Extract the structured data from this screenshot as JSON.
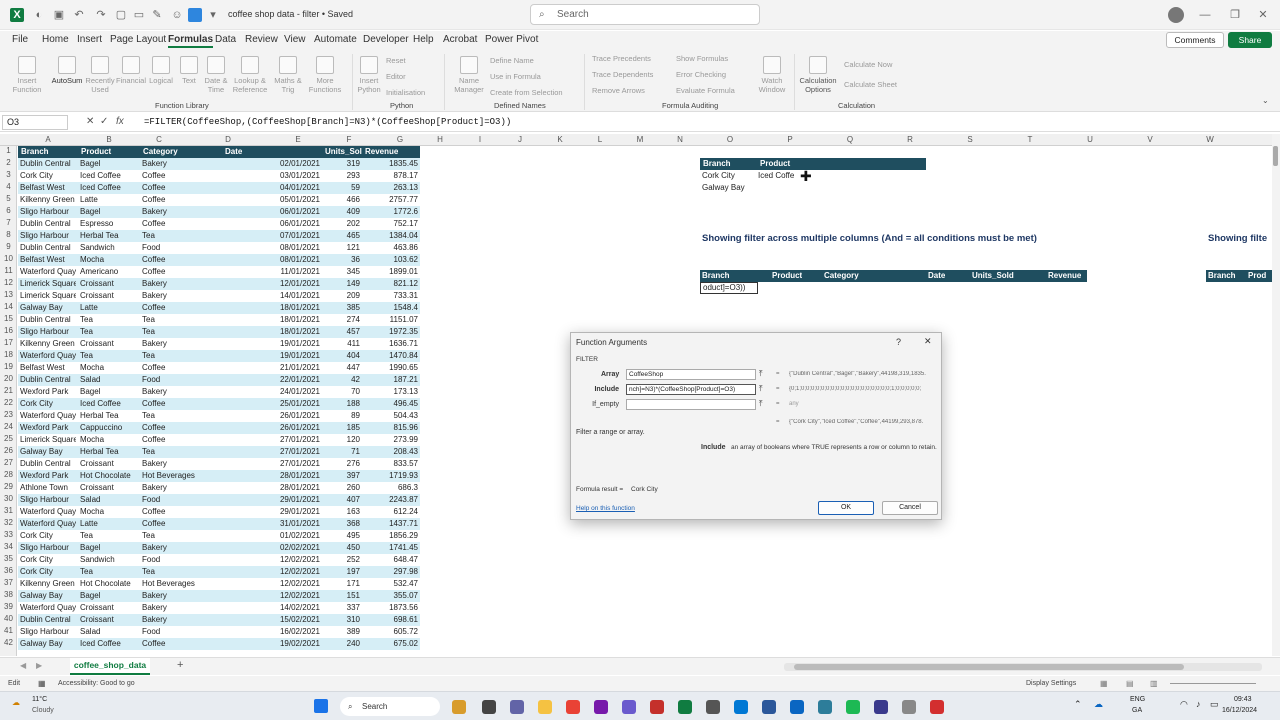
{
  "app": {
    "title": "coffee shop data - filter • Saved",
    "search_placeholder": "Search"
  },
  "menus": [
    "File",
    "Home",
    "Insert",
    "Page Layout",
    "Formulas",
    "Data",
    "Review",
    "View",
    "Automate",
    "Developer",
    "Help",
    "Acrobat",
    "Power Pivot"
  ],
  "menu_active": "Formulas",
  "actions": {
    "comments": "Comments",
    "share": "Share"
  },
  "ribbon": {
    "function_library": {
      "label": "Function Library",
      "items": [
        "Insert Function",
        "AutoSum",
        "Recently Used",
        "Financial",
        "Logical",
        "Text",
        "Date & Time",
        "Lookup & Reference",
        "Maths & Trig",
        "More Functions"
      ]
    },
    "python": {
      "label": "Python",
      "items": [
        "Insert Python",
        "Reset",
        "Editor",
        "Initialisation"
      ]
    },
    "defined_names": {
      "label": "Defined Names",
      "items": [
        "Name Manager",
        "Define Name",
        "Use in Formula",
        "Create from Selection"
      ]
    },
    "formula_auditing": {
      "label": "Formula Auditing",
      "items": [
        "Trace Precedents",
        "Trace Dependents",
        "Remove Arrows",
        "Show Formulas",
        "Error Checking",
        "Evaluate Formula",
        "Watch Window"
      ]
    },
    "calculation": {
      "label": "Calculation",
      "items": [
        "Calculation Options",
        "Calculate Now",
        "Calculate Sheet"
      ]
    }
  },
  "formula_bar": {
    "cell": "O3",
    "fx": "fx",
    "formula": "=FILTER(CoffeeShop,(CoffeeShop[Branch]=N3)*(CoffeeShop[Product]=O3))"
  },
  "columns": [
    "A",
    "B",
    "C",
    "D",
    "E",
    "F",
    "G",
    "H",
    "I",
    "J",
    "K",
    "L",
    "M",
    "N",
    "O",
    "P",
    "Q",
    "R",
    "S",
    "T",
    "U",
    "V",
    "W"
  ],
  "table_headers": [
    "Branch",
    "Product",
    "Category",
    "Date",
    "Units_Sold",
    "Revenue"
  ],
  "rows": [
    [
      "Dublin Central",
      "Bagel",
      "Bakery",
      "02/01/2021",
      "319",
      "1835.45"
    ],
    [
      "Cork City",
      "Iced Coffee",
      "Coffee",
      "03/01/2021",
      "293",
      "878.17"
    ],
    [
      "Belfast West",
      "Iced Coffee",
      "Coffee",
      "04/01/2021",
      "59",
      "263.13"
    ],
    [
      "Kilkenny Green",
      "Latte",
      "Coffee",
      "05/01/2021",
      "466",
      "2757.77"
    ],
    [
      "Sligo Harbour",
      "Bagel",
      "Bakery",
      "06/01/2021",
      "409",
      "1772.6"
    ],
    [
      "Dublin Central",
      "Espresso",
      "Coffee",
      "06/01/2021",
      "202",
      "752.17"
    ],
    [
      "Sligo Harbour",
      "Herbal Tea",
      "Tea",
      "07/01/2021",
      "465",
      "1384.04"
    ],
    [
      "Dublin Central",
      "Sandwich",
      "Food",
      "08/01/2021",
      "121",
      "463.86"
    ],
    [
      "Belfast West",
      "Mocha",
      "Coffee",
      "08/01/2021",
      "36",
      "103.62"
    ],
    [
      "Waterford Quay",
      "Americano",
      "Coffee",
      "11/01/2021",
      "345",
      "1899.01"
    ],
    [
      "Limerick Square",
      "Croissant",
      "Bakery",
      "12/01/2021",
      "149",
      "821.12"
    ],
    [
      "Limerick Square",
      "Croissant",
      "Bakery",
      "14/01/2021",
      "209",
      "733.31"
    ],
    [
      "Galway Bay",
      "Latte",
      "Coffee",
      "18/01/2021",
      "385",
      "1548.4"
    ],
    [
      "Dublin Central",
      "Tea",
      "Tea",
      "18/01/2021",
      "274",
      "1151.07"
    ],
    [
      "Sligo Harbour",
      "Tea",
      "Tea",
      "18/01/2021",
      "457",
      "1972.35"
    ],
    [
      "Kilkenny Green",
      "Croissant",
      "Bakery",
      "19/01/2021",
      "411",
      "1636.71"
    ],
    [
      "Waterford Quay",
      "Tea",
      "Tea",
      "19/01/2021",
      "404",
      "1470.84"
    ],
    [
      "Belfast West",
      "Mocha",
      "Coffee",
      "21/01/2021",
      "447",
      "1990.65"
    ],
    [
      "Dublin Central",
      "Salad",
      "Food",
      "22/01/2021",
      "42",
      "187.21"
    ],
    [
      "Wexford Park",
      "Bagel",
      "Bakery",
      "24/01/2021",
      "70",
      "173.13"
    ],
    [
      "Cork City",
      "Iced Coffee",
      "Coffee",
      "25/01/2021",
      "188",
      "496.45"
    ],
    [
      "Waterford Quay",
      "Herbal Tea",
      "Tea",
      "26/01/2021",
      "89",
      "504.43"
    ],
    [
      "Wexford Park",
      "Cappuccino",
      "Coffee",
      "26/01/2021",
      "185",
      "815.96"
    ],
    [
      "Limerick Square",
      "Mocha",
      "Coffee",
      "27/01/2021",
      "120",
      "273.99"
    ],
    [
      "Galway Bay",
      "Herbal Tea",
      "Tea",
      "27/01/2021",
      "71",
      "208.43"
    ],
    [
      "Dublin Central",
      "Croissant",
      "Bakery",
      "27/01/2021",
      "276",
      "833.57"
    ],
    [
      "Wexford Park",
      "Hot Chocolate",
      "Hot Beverages",
      "28/01/2021",
      "397",
      "1719.93"
    ],
    [
      "Athlone Town",
      "Croissant",
      "Bakery",
      "28/01/2021",
      "260",
      "686.3"
    ],
    [
      "Sligo Harbour",
      "Salad",
      "Food",
      "29/01/2021",
      "407",
      "2243.87"
    ],
    [
      "Waterford Quay",
      "Mocha",
      "Coffee",
      "29/01/2021",
      "163",
      "612.24"
    ],
    [
      "Waterford Quay",
      "Latte",
      "Coffee",
      "31/01/2021",
      "368",
      "1437.71"
    ],
    [
      "Cork City",
      "Tea",
      "Tea",
      "01/02/2021",
      "495",
      "1856.29"
    ],
    [
      "Sligo Harbour",
      "Bagel",
      "Bakery",
      "02/02/2021",
      "450",
      "1741.45"
    ],
    [
      "Cork City",
      "Sandwich",
      "Food",
      "12/02/2021",
      "252",
      "648.47"
    ],
    [
      "Cork City",
      "Tea",
      "Tea",
      "12/02/2021",
      "197",
      "297.98"
    ],
    [
      "Kilkenny Green",
      "Hot Chocolate",
      "Hot Beverages",
      "12/02/2021",
      "171",
      "532.47"
    ],
    [
      "Galway Bay",
      "Bagel",
      "Bakery",
      "12/02/2021",
      "151",
      "355.07"
    ],
    [
      "Waterford Quay",
      "Croissant",
      "Bakery",
      "14/02/2021",
      "337",
      "1873.56"
    ],
    [
      "Dublin Central",
      "Croissant",
      "Bakery",
      "15/02/2021",
      "310",
      "698.61"
    ],
    [
      "Sligo Harbour",
      "Salad",
      "Food",
      "16/02/2021",
      "389",
      "605.72"
    ],
    [
      "Galway Bay",
      "Iced Coffee",
      "Coffee",
      "19/02/2021",
      "240",
      "675.02"
    ]
  ],
  "criteria": {
    "headers": [
      "Branch",
      "Product"
    ],
    "row1": [
      "Cork City",
      "Iced Coffe"
    ],
    "row2": [
      "Galway Bay",
      ""
    ]
  },
  "section_title": "Showing filter across multiple columns (And = all conditions must be met)",
  "section_title_2": "Showing filte",
  "result_headers": [
    "Branch",
    "Product",
    "Category",
    "Date",
    "Units_Sold",
    "Revenue"
  ],
  "result_headers_2": [
    "Branch",
    "Prod"
  ],
  "editing_cell": "oduct]=O3))",
  "dialog": {
    "title": "Function Arguments",
    "func": "FILTER",
    "args": [
      {
        "label": "Array",
        "value": "CoffeeShop",
        "result": "{\"Dublin Central\",\"Bagel\",\"Bakery\",44198,319,1835."
      },
      {
        "label": "Include",
        "value": "nch]=N3)*(CoffeeShop[Product]=O3)",
        "result": "{0;1;0;0;0;0;0;0;0;0;0;0;0;0;0;0;0;0;0;0;1;0;0;0;0;0;"
      },
      {
        "label": "If_empty",
        "value": "",
        "result": "any"
      }
    ],
    "overall_result": "{\"Cork City\",\"Iced Coffee\",\"Coffee\",44199,293,878.",
    "desc": "Filter a range or array.",
    "arg_name": "Include",
    "arg_desc": "an array of booleans where TRUE represents a row or column to retain.",
    "formula_result_label": "Formula result =",
    "formula_result": "Cork City",
    "help": "Help on this function",
    "ok": "OK",
    "cancel": "Cancel"
  },
  "sheet_tab": "coffee_shop_data",
  "status": {
    "mode": "Edit",
    "accessibility": "Accessibility: Good to go",
    "display": "Display Settings"
  },
  "taskbar": {
    "weather_temp": "11°C",
    "weather_desc": "Cloudy",
    "search": "Search",
    "lang1": "ENG",
    "lang2": "GA",
    "time": "09:43",
    "date": "16/12/2024"
  }
}
